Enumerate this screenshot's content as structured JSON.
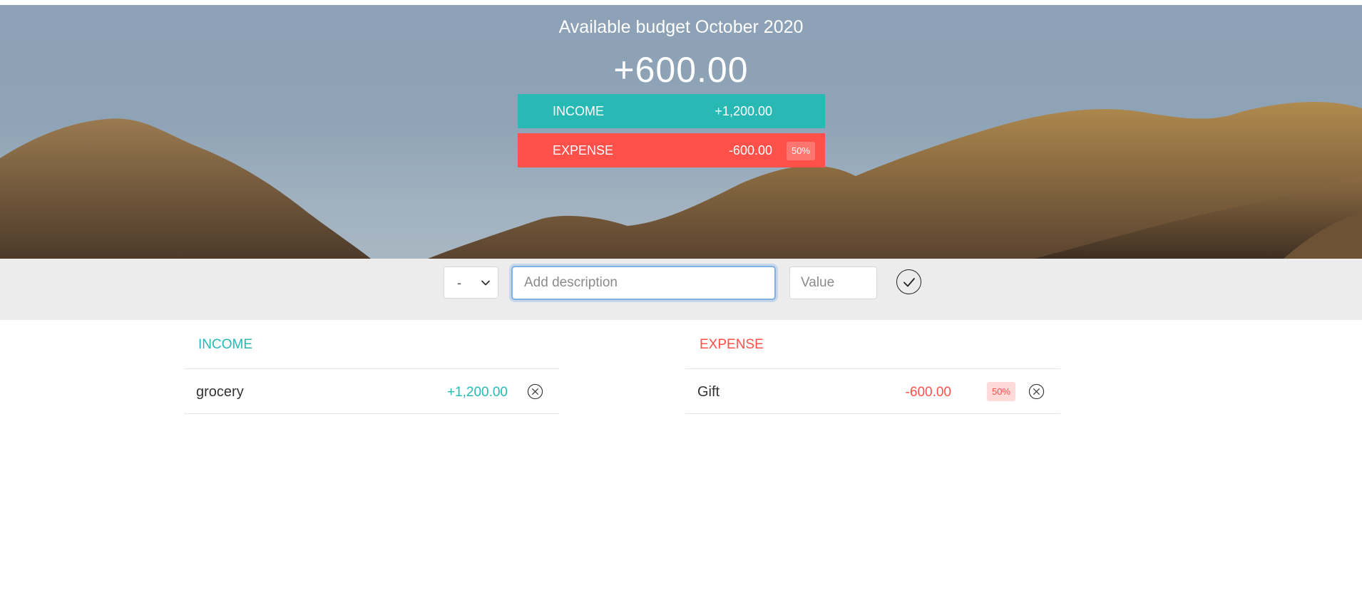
{
  "header": {
    "title": "Available budget October 2020",
    "budget_value": "+600.00",
    "income": {
      "label": "INCOME",
      "value": "+1,200.00"
    },
    "expense": {
      "label": "EXPENSE",
      "value": "-600.00",
      "percentage": "50%"
    }
  },
  "add_form": {
    "type_select": {
      "selected": "-",
      "icon": "chevron-down-icon"
    },
    "description": {
      "value": "",
      "placeholder": "Add description"
    },
    "value": {
      "value": "",
      "placeholder": "Value"
    },
    "submit_icon": "checkmark-circle-icon"
  },
  "income_list": {
    "title": "INCOME",
    "items": [
      {
        "description": "grocery",
        "value": "+1,200.00"
      }
    ]
  },
  "expense_list": {
    "title": "EXPENSE",
    "items": [
      {
        "description": "Gift",
        "value": "-600.00",
        "percentage": "50%"
      }
    ]
  },
  "colors": {
    "income": "#28b9b5",
    "expense": "#ff5049",
    "focus": "#7fb1e6",
    "add_bar": "#ececec"
  }
}
